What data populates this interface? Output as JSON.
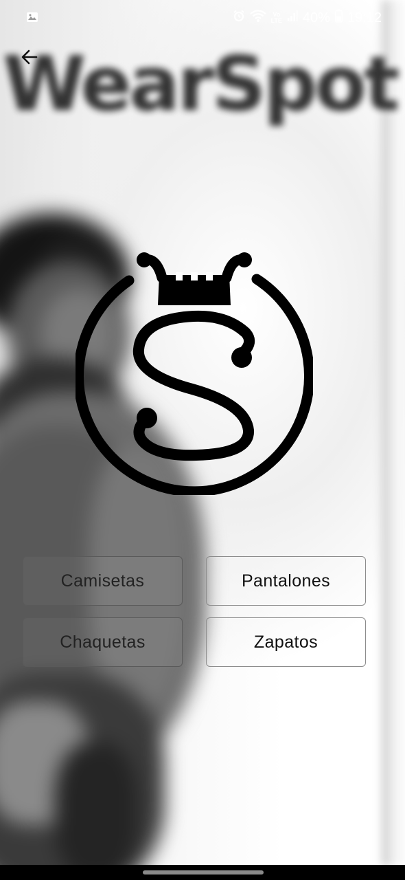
{
  "status_bar": {
    "battery": "40%",
    "time": "19:12",
    "network_badge_top": "Vo",
    "network_badge_bottom": "LTE",
    "icons": [
      "gallery-icon",
      "alarm-icon",
      "wifi-icon",
      "volte-icon",
      "signal-icon",
      "battery-icon"
    ]
  },
  "header": {
    "back_icon": "arrow-back-icon",
    "brand_text": "WearSpot"
  },
  "logo": {
    "description_icon": "crowned-s-logo-icon",
    "color": "#000000"
  },
  "categories": [
    {
      "label": "Camisetas"
    },
    {
      "label": "Pantalones"
    },
    {
      "label": "Chaquetas"
    },
    {
      "label": "Zapatos"
    }
  ],
  "colors": {
    "button_border": "#8c8c8c",
    "button_text": "#111111",
    "nav_bar": "#000000",
    "status_text": "#ffffff"
  }
}
